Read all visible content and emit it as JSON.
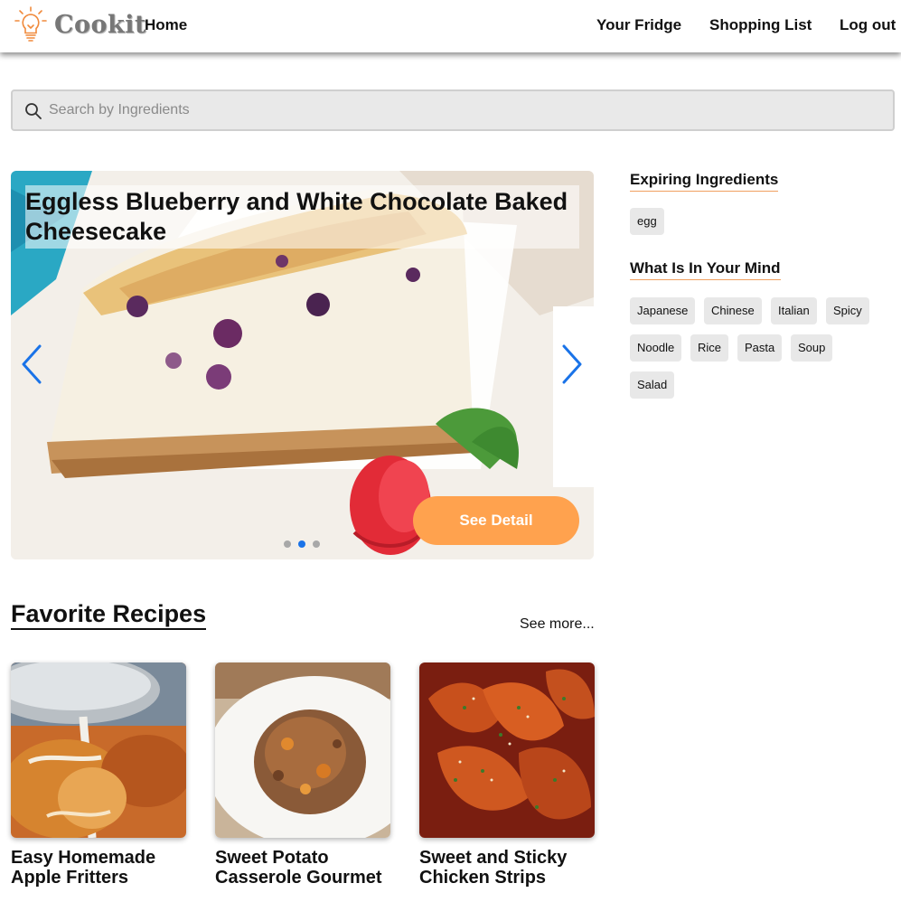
{
  "header": {
    "brand": "Cookit",
    "nav": {
      "home": "Home",
      "fridge": "Your Fridge",
      "shopping": "Shopping List",
      "logout": "Log out"
    }
  },
  "search": {
    "placeholder": "Search by Ingredients",
    "value": ""
  },
  "carousel": {
    "title": "Eggless Blueberry and White Chocolate Baked Cheesecake",
    "button": "See Detail",
    "slide_count": 3,
    "active_slide": 2
  },
  "sidebar": {
    "expiring_heading": "Expiring Ingredients",
    "expiring": [
      "egg"
    ],
    "mind_heading": "What Is In Your Mind",
    "mind_tags": [
      "Japanese",
      "Chinese",
      "Italian",
      "Spicy",
      "Noodle",
      "Rice",
      "Pasta",
      "Soup",
      "Salad"
    ]
  },
  "favorites": {
    "heading": "Favorite Recipes",
    "see_more": "See more...",
    "recipes": [
      {
        "title": "Easy Homemade Apple Fritters"
      },
      {
        "title": "Sweet Potato Casserole Gourmet"
      },
      {
        "title": "Sweet and Sticky Chicken Strips"
      }
    ]
  },
  "colors": {
    "accent": "#ffa24e",
    "arrow": "#1a73e8",
    "chip": "#e8e8e8"
  },
  "icons": {
    "logo": "lightbulb-icon",
    "search": "search-icon",
    "prev": "chevron-left-icon",
    "next": "chevron-right-icon"
  }
}
